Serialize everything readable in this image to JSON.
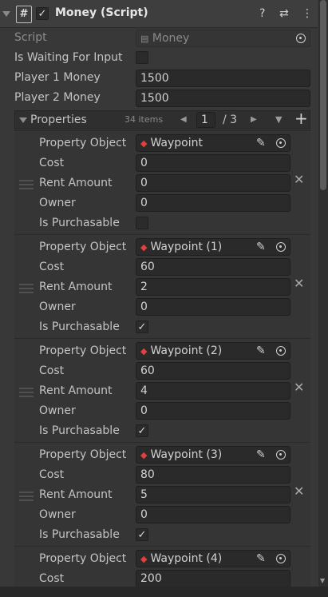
{
  "header": {
    "title": "Money (Script)",
    "enabled": true,
    "icons": [
      "help-icon",
      "presets-icon",
      "more-icon"
    ]
  },
  "fields": {
    "script_label": "Script",
    "script_value": "Money",
    "waiting_label": "Is Waiting For Input",
    "waiting_value": false,
    "p1_label": "Player 1 Money",
    "p1_value": "1500",
    "p2_label": "Player 2 Money",
    "p2_value": "1500"
  },
  "properties": {
    "label": "Properties",
    "count": "34 items",
    "page": "1",
    "page_total": "/ 3",
    "elements": [
      {
        "object": "Waypoint",
        "cost": "0",
        "rent": "0",
        "owner": "0",
        "purchasable": false
      },
      {
        "object": "Waypoint (1)",
        "cost": "60",
        "rent": "2",
        "owner": "0",
        "purchasable": true
      },
      {
        "object": "Waypoint (2)",
        "cost": "60",
        "rent": "4",
        "owner": "0",
        "purchasable": true
      },
      {
        "object": "Waypoint (3)",
        "cost": "80",
        "rent": "5",
        "owner": "0",
        "purchasable": true
      },
      {
        "object": "Waypoint (4)",
        "cost": "200"
      }
    ]
  },
  "element_labels": {
    "object": "Property Object",
    "cost": "Cost",
    "rent": "Rent Amount",
    "owner": "Owner",
    "purchasable": "Is Purchasable"
  },
  "colors": {
    "background": "#383838",
    "field": "#2a2a2a",
    "text": "#c4c4c4",
    "object_icon": "#e04040"
  }
}
